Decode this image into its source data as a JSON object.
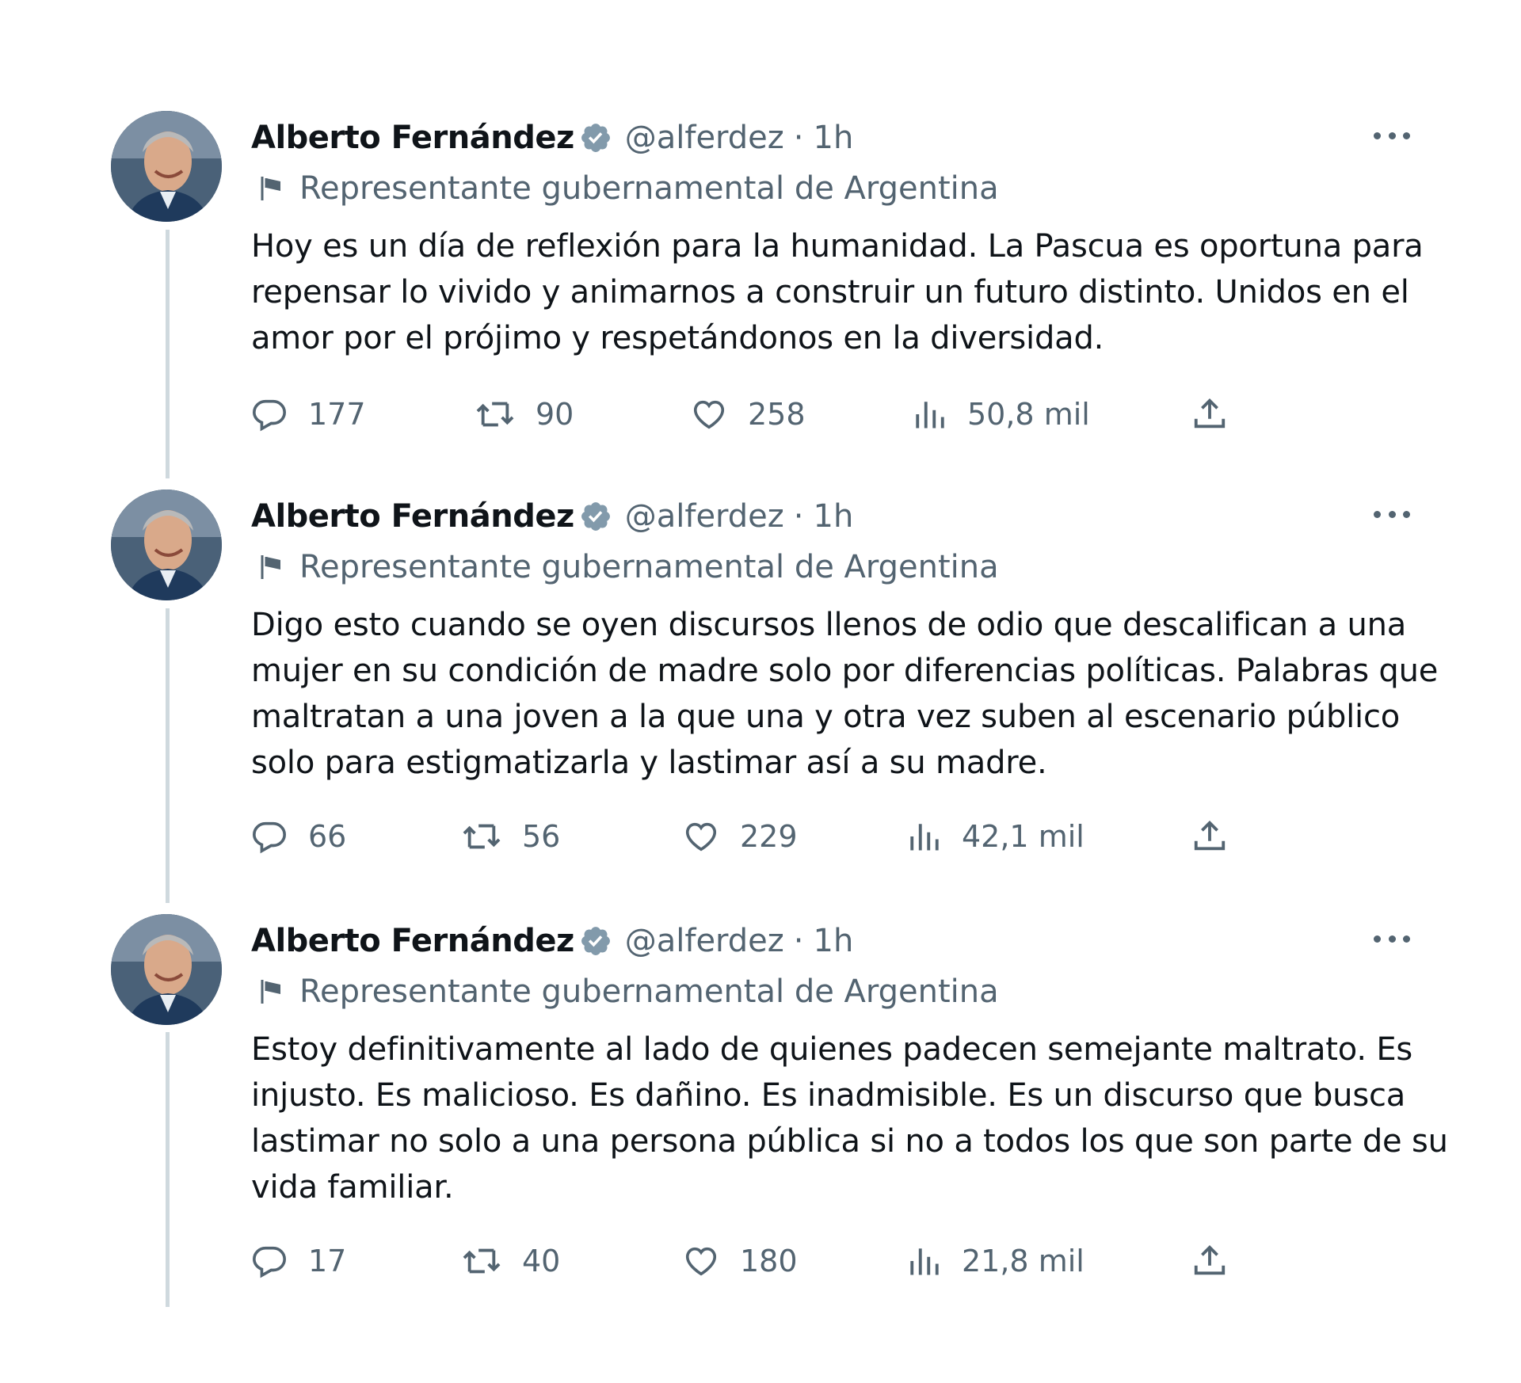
{
  "tweets": [
    {
      "author_name": "Alberto Fernández",
      "handle": "@alferdez",
      "separator": "·",
      "time": "1h",
      "label": "Representante gubernamental de Argentina",
      "lines": [
        "Hoy es un día de reflexión para la humanidad. La Pascua es oportuna para",
        "repensar lo vivido y animarnos a construir un futuro distinto. Unidos en el",
        "amor por el prójimo y respetándonos en la diversidad."
      ],
      "replies": "177",
      "retweets": "90",
      "likes": "258",
      "views": "50,8 mil"
    },
    {
      "author_name": "Alberto Fernández",
      "handle": "@alferdez",
      "separator": "·",
      "time": "1h",
      "label": "Representante gubernamental de Argentina",
      "lines": [
        "Digo esto cuando se oyen discursos llenos de odio que descalifican a una",
        "mujer en su condición de madre solo por diferencias políticas. Palabras que",
        "maltratan a una joven a la que una y otra vez suben al escenario público",
        "solo para estigmatizarla y lastimar así a su madre."
      ],
      "replies": "66",
      "retweets": "56",
      "likes": "229",
      "views": "42,1 mil"
    },
    {
      "author_name": "Alberto Fernández",
      "handle": "@alferdez",
      "separator": "·",
      "time": "1h",
      "label": "Representante gubernamental de Argentina",
      "lines": [
        "Estoy definitivamente al lado de quienes padecen semejante maltrato. Es",
        "injusto. Es malicioso. Es dañino. Es inadmisible. Es un discurso que busca",
        "lastimar no solo a una persona pública si no a todos los que son parte de su",
        "vida familiar."
      ],
      "replies": "17",
      "retweets": "40",
      "likes": "180",
      "views": "21,8 mil"
    }
  ],
  "colors": {
    "text_primary": "#0f1419",
    "text_secondary": "#536471",
    "thread_line": "#cfd9de",
    "verified_badge": "#829aab"
  },
  "icons": {
    "verified": "verified-badge-icon",
    "label": "flag-icon",
    "more": "more-options-icon",
    "reply": "reply-icon",
    "retweet": "retweet-icon",
    "like": "heart-icon",
    "views": "views-icon",
    "share": "share-icon"
  }
}
